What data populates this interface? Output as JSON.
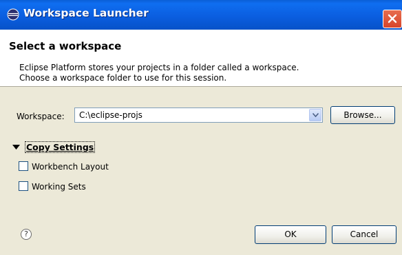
{
  "window": {
    "title": "Workspace Launcher"
  },
  "banner": {
    "heading": "Select a workspace",
    "description_line1": "Eclipse Platform stores your projects in a folder called a workspace.",
    "description_line2": "Choose a workspace folder to use for this session."
  },
  "workspace": {
    "label": "Workspace:",
    "value": "C:\\eclipse-projs",
    "browse_label": "Browse..."
  },
  "copy_settings": {
    "title": "Copy Settings",
    "options": [
      {
        "label": "Workbench Layout",
        "checked": false
      },
      {
        "label": "Working Sets",
        "checked": false
      }
    ]
  },
  "buttons": {
    "ok": "OK",
    "cancel": "Cancel"
  },
  "help": {
    "glyph": "?"
  },
  "colors": {
    "titlebar": "#0b5ee0",
    "dialog_bg": "#ece9d8",
    "close_button": "#d7452a"
  }
}
